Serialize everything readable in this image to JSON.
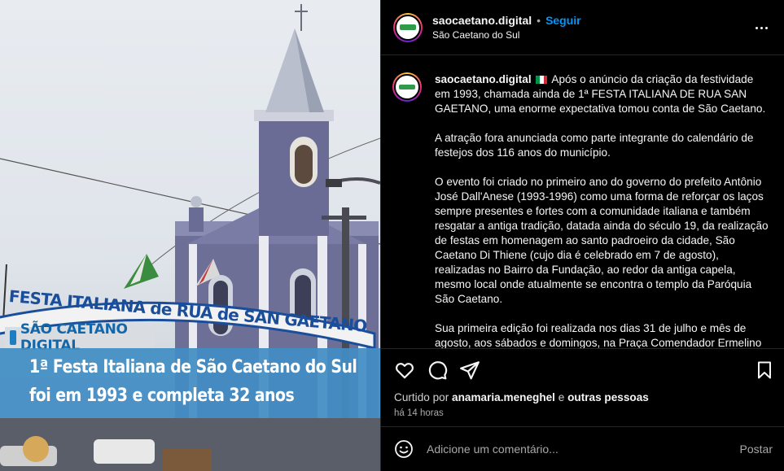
{
  "media": {
    "banner_text": "FESTA ITALIANA de RUA de SAN GAETANO",
    "brand": "SÃO CAETANO DIGITAL",
    "caption_line1": "1ª Festa Italiana de São Caetano do Sul",
    "caption_line2": "foi em 1993 e completa 32 anos"
  },
  "header": {
    "username": "saocaetano.digital",
    "dot": "•",
    "follow_label": "Seguir",
    "location": "São Caetano do Sul",
    "more_icon": "more-horizontal-icon"
  },
  "caption": {
    "username": "saocaetano.digital",
    "flag_colors": [
      "#009246",
      "#ffffff",
      "#ce2b37"
    ],
    "paragraphs": [
      "Após o anúncio da criação da festividade em 1993, chamada ainda de 1ª FESTA ITALIANA DE RUA SAN GAETANO, uma enorme expectativa tomou conta de São Caetano.",
      "A atração fora anunciada como parte integrante do calendário de festejos dos 116 anos do município.",
      "O evento foi criado no primeiro ano do governo do prefeito Antônio José Dall'Anese (1993-1996) como uma forma de reforçar os laços sempre presentes e fortes com a comunidade italiana e também resgatar a antiga tradição, datada ainda do século 19, da realização de festas em homenagem ao santo padroeiro da cidade, São Caetano Di Thiene (cujo dia é celebrado em 7 de agosto), realizadas no Bairro da Fundação, ao redor da antiga capela, mesmo local onde atualmente se encontra o templo da Paróquia São Caetano.",
      "Sua primeira edição foi realizada nos dias 31 de julho e mês de agosto, aos sábados e domingos, na Praça Comendador Ermelino"
    ]
  },
  "actions": {
    "icons": [
      "heart-icon",
      "comment-icon",
      "share-icon",
      "bookmark-icon"
    ],
    "liked_prefix": "Curtido por",
    "liked_user": "anamaria.meneghel",
    "liked_and": "e",
    "liked_others": "outras pessoas",
    "time_ago": "há 14 horas"
  },
  "composer": {
    "placeholder": "Adicione um comentário...",
    "post_label": "Postar"
  },
  "colors": {
    "accent": "#0095f6",
    "background": "#000000",
    "caption_box": "#428dc4",
    "brand_blue": "#1366a8"
  }
}
